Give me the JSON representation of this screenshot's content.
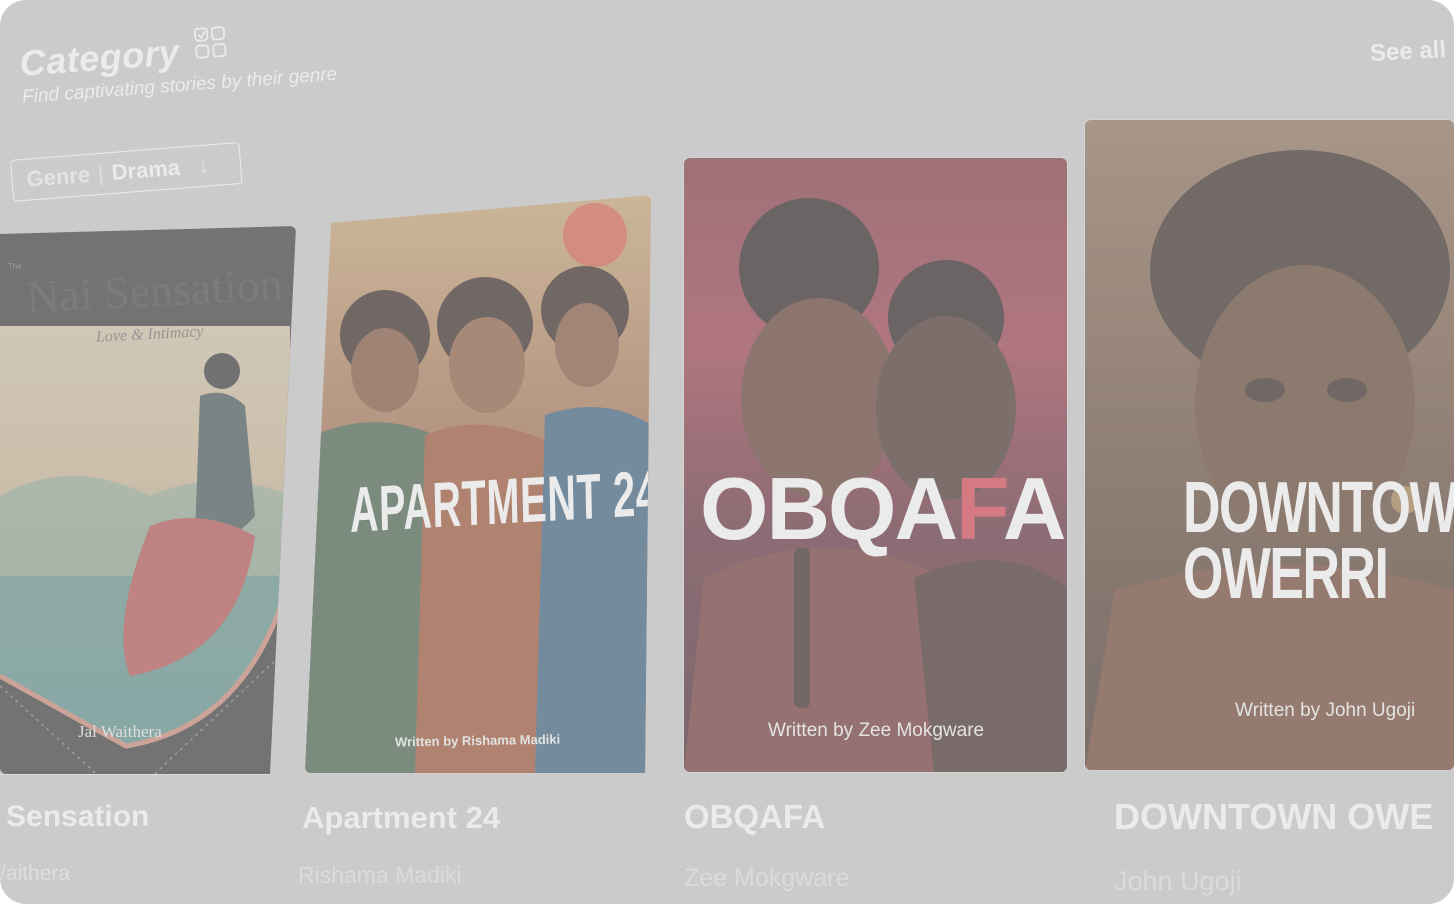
{
  "header": {
    "title": "Category",
    "subtitle": "Find captivating stories by their genre",
    "see_all": "See all"
  },
  "filter": {
    "label": "Genre",
    "separator": "|",
    "value": "Drama"
  },
  "stories": [
    {
      "poster_title": "Nai Sensation",
      "poster_tag": "Love & Intimacy",
      "poster_tiny": "The",
      "poster_author": "Jal Waithera",
      "title": "Sensation",
      "author": "/aithera"
    },
    {
      "poster_title": "APARTMENT 24",
      "poster_credit": "Written by Rishama Madiki",
      "title": "Apartment 24",
      "author": "Rishama Madiki"
    },
    {
      "poster_title_a": "OBQA",
      "poster_title_f": "F",
      "poster_title_b": "A",
      "poster_credit": "Written by Zee Mokgware",
      "title": "OBQAFA",
      "author": "Zee Mokgware"
    },
    {
      "poster_title_line1": "DOWNTOWN",
      "poster_title_line2": "OWERRI",
      "poster_credit": "Written by John Ugoji",
      "title": "DOWNTOWN OWE",
      "author": "John Ugoji"
    }
  ],
  "colors": {
    "background": "#cbcbcb",
    "text": "#ffffff",
    "accent_red": "#d83a48"
  },
  "icons": {
    "category": "checklist-grid-icon",
    "dropdown": "arrow-down-icon"
  }
}
